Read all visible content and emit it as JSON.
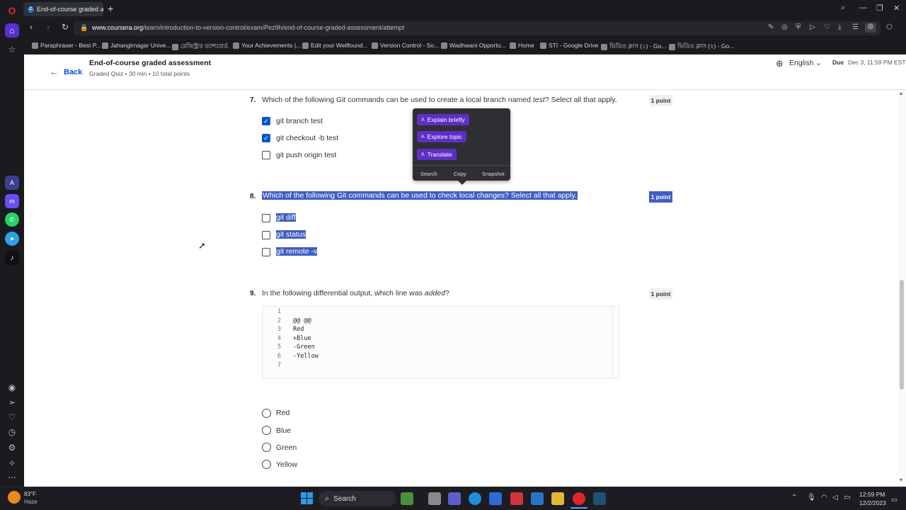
{
  "browser": {
    "tab_title": "End-of-course graded ass",
    "url_domain": "www.coursera.org",
    "url_path": "/learn/introduction-to-version-control/exam/Pez9h/end-of-course-graded-assessment/attempt",
    "bookmarks": [
      "Paraphraser - Best P...",
      "Jahangirnagar Unive...",
      "রেজিস্ট্রার ড্যাশবোর্ড",
      "Your Achievements |...",
      "Edit your Wellfound...",
      "Version Control - So...",
      "Wadhwani Opportu...",
      "Home",
      "STI - Google Drive",
      "ভিডিও ক্লাস (১) - Go...",
      "ভিডিও ক্লাস (২) - Go..."
    ]
  },
  "header": {
    "back_label": "Back",
    "title": "End-of-course graded assessment",
    "subtitle": "Graded Quiz • 30 min • 10 total points",
    "language": "English",
    "due_label": "Due",
    "due_date": "Dec 3, 11:59 PM EST"
  },
  "questions": [
    {
      "number": "7.",
      "text_before": "Which of the following Git commands can be used to create a local branch named ",
      "text_em": "test",
      "text_after": "? Select all that apply.",
      "points": "1 point",
      "options": [
        {
          "label": "git branch test",
          "checked": true
        },
        {
          "label": "git checkout -b test",
          "checked": true
        },
        {
          "label": "git push origin test",
          "checked": false
        }
      ]
    },
    {
      "number": "8.",
      "text": "Which of the following Git commands can be used to check local changes? Select all that apply.",
      "points": "1 point",
      "options": [
        {
          "label": "git diff",
          "checked": false
        },
        {
          "label": "git status",
          "checked": false
        },
        {
          "label": "git remote -v",
          "checked": false
        }
      ]
    },
    {
      "number": "9.",
      "text_before": "In the following differential output, which line was ",
      "text_em": "added",
      "text_after": "?",
      "points": "1 point",
      "code": [
        {
          "n": "1",
          "t": ""
        },
        {
          "n": "2",
          "t": "@@ @@"
        },
        {
          "n": "3",
          "t": "Red"
        },
        {
          "n": "4",
          "t": "+Blue"
        },
        {
          "n": "5",
          "t": "-Green"
        },
        {
          "n": "6",
          "t": "-Yellow"
        },
        {
          "n": "7",
          "t": ""
        }
      ],
      "options": [
        "Red",
        "Blue",
        "Green",
        "Yellow"
      ]
    }
  ],
  "popup": {
    "buttons": [
      "Explain briefly",
      "Explore topic",
      "Translate"
    ],
    "actions": [
      "Search",
      "Copy",
      "Snapshot"
    ]
  },
  "taskbar": {
    "temp": "83°F",
    "weather": "Haze",
    "search": "Search",
    "time": "12:59 PM",
    "date": "12/2/2023"
  },
  "colors": {
    "accent": "#0056d2",
    "selection": "#3f5ec3",
    "popup_button": "#5d2fc6"
  }
}
